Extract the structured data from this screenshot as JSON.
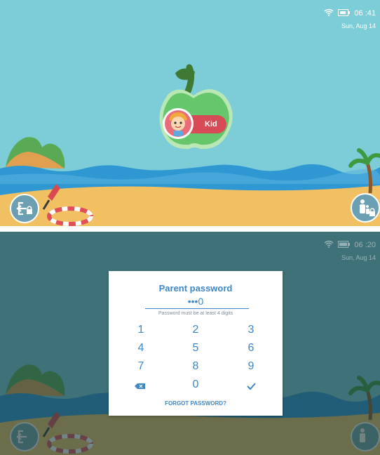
{
  "home_screen": {
    "status_bar": {
      "time": "06 :41",
      "date": "Sun, Aug 14"
    },
    "profile": {
      "name": "Kid"
    },
    "icons": {
      "exit": "exit-lock-icon",
      "parent": "parent-child-lock-icon",
      "wifi": "wifi-icon",
      "battery": "battery-icon"
    }
  },
  "password_screen": {
    "status_bar": {
      "time": "06 :20",
      "date": "Sun, Aug 14"
    },
    "dialog": {
      "title": "Parent password",
      "entry": "•••0",
      "hint": "Password must be at least 4 digits",
      "keys": [
        "1",
        "2",
        "3",
        "4",
        "5",
        "6",
        "7",
        "8",
        "9"
      ],
      "zero_key": "0",
      "delete_icon": "backspace-icon",
      "confirm_icon": "checkmark-icon",
      "forgot_label": "FORGOT PASSWORD?"
    }
  },
  "colors": {
    "sky": "#7ccdd7",
    "sea": "#2f97d2",
    "sand": "#f0c063",
    "apple": "#66c66c",
    "accent_red": "#d64b55",
    "dialog_text": "#3f87c8",
    "overlay": "#1a3a3d"
  }
}
